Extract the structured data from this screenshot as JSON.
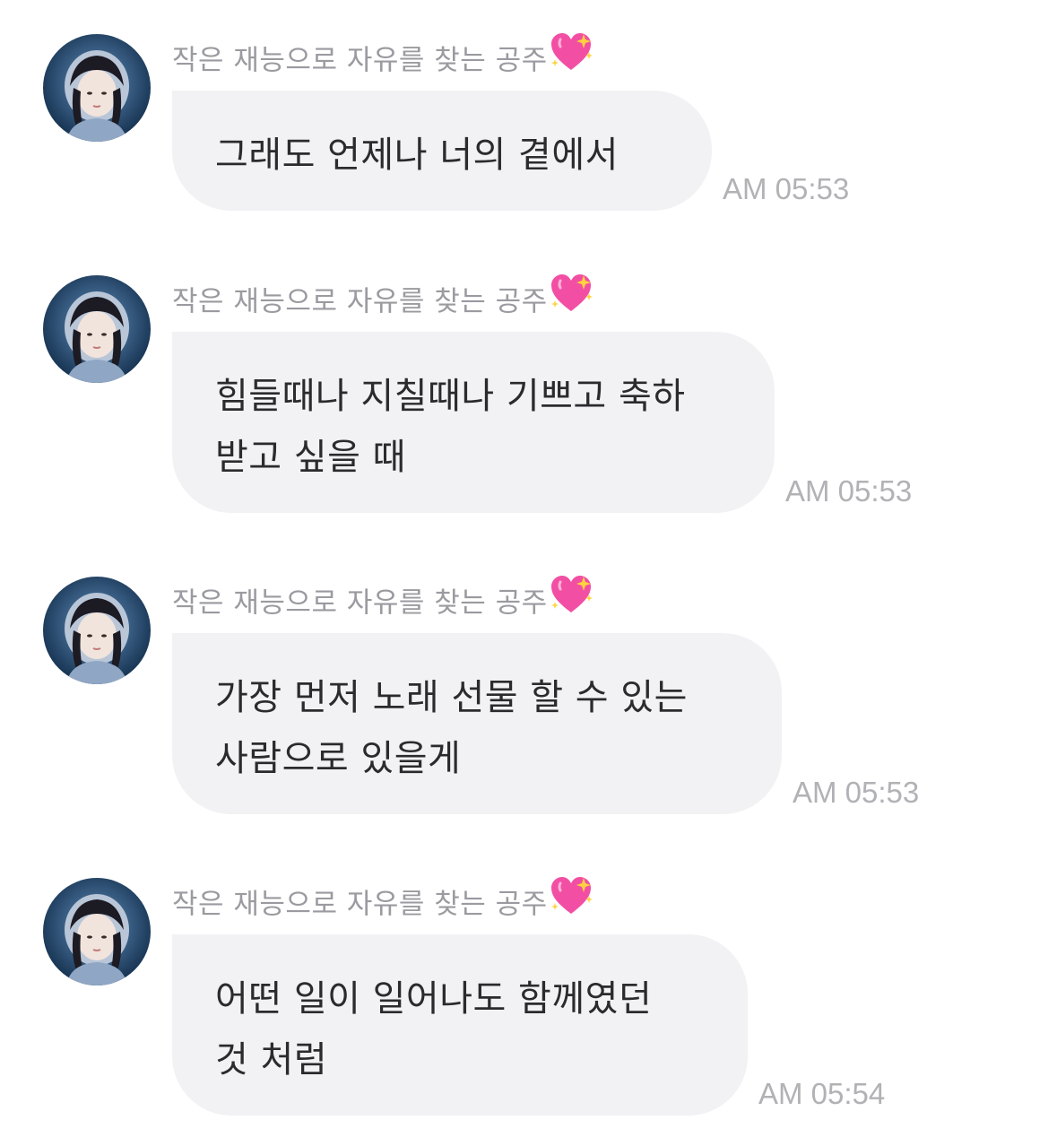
{
  "sender_name": "작은 재능으로 자유를 찾는 공주",
  "sender_emoji": "sparkling-heart-icon",
  "accent_color": "#f24fa4",
  "messages": [
    {
      "lines": [
        "그래도 언제나 너의 곁에서"
      ],
      "time": "AM 05:53"
    },
    {
      "lines": [
        "힘들때나 지칠때나 기쁘고 축하",
        "받고 싶을 때"
      ],
      "time": "AM 05:53"
    },
    {
      "lines": [
        "가장 먼저 노래 선물 할 수 있는",
        "사람으로 있을게"
      ],
      "time": "AM 05:53"
    },
    {
      "lines": [
        "어떤 일이 일어나도 함께였던",
        "것 처럼"
      ],
      "time": "AM 05:54"
    }
  ]
}
